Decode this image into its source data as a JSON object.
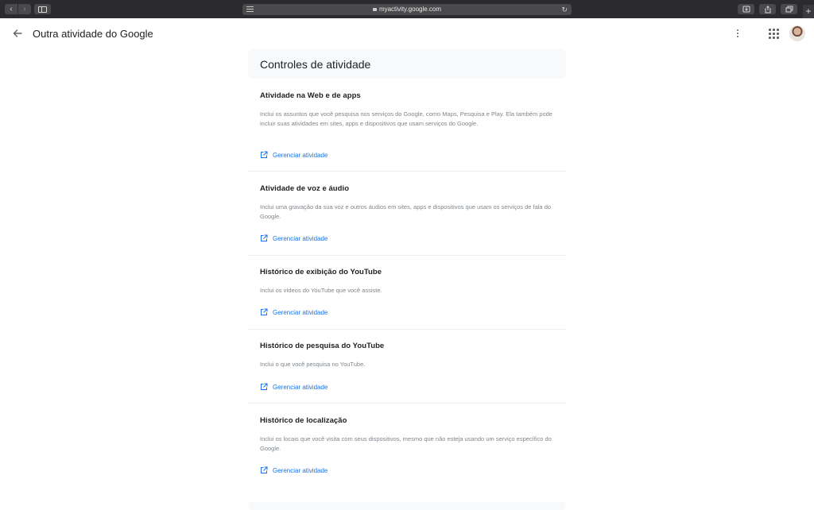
{
  "browser": {
    "back_glyph": "‹",
    "forward_glyph": "›",
    "url": "myactivity.google.com",
    "reload_glyph": "↻",
    "new_tab_glyph": "+",
    "icons": [
      "back-icon",
      "forward-icon",
      "sidebar-icon",
      "reader-icon",
      "lock-icon",
      "reload-icon",
      "downloads-icon",
      "share-icon",
      "tabs-icon",
      "plus-icon"
    ]
  },
  "header": {
    "title": "Outra atividade do Google",
    "icons": [
      "arrow-back-icon",
      "more-vert-icon",
      "apps-grid-icon",
      "account-avatar"
    ]
  },
  "main": {
    "heading": "Controles de atividade",
    "sections": [
      {
        "title": "Atividade na Web e de apps",
        "description": "Inclui os assuntos que você pesquisa nos serviços do Google, como Maps, Pesquisa e Play. Ela também pode incluir suas atividades em sites, apps e dispositivos que usam serviços do Google.",
        "link": "Gerenciar atividade"
      },
      {
        "title": "Atividade de voz e áudio",
        "description": "Inclui uma gravação da sua voz e outros áudios em sites, apps e dispositivos que usam os serviços de fala do Google.",
        "link": "Gerenciar atividade"
      },
      {
        "title": "Histórico de exibição do YouTube",
        "description": "Inclui os vídeos do YouTube que você assiste.",
        "link": "Gerenciar atividade"
      },
      {
        "title": "Histórico de pesquisa do YouTube",
        "description": "Inclui o que você pesquisa no YouTube.",
        "link": "Gerenciar atividade"
      },
      {
        "title": "Histórico de localização",
        "description": "Inclui os locais que você visita com seus dispositivos, mesmo que não esteja usando um serviço específico do Google.",
        "link": "Gerenciar atividade"
      }
    ]
  },
  "colors": {
    "link": "#1a73e8",
    "text_primary": "#202124",
    "text_secondary": "#80868b",
    "card_bg": "#f8f9fa",
    "chrome_bg": "#2b2b2d"
  }
}
